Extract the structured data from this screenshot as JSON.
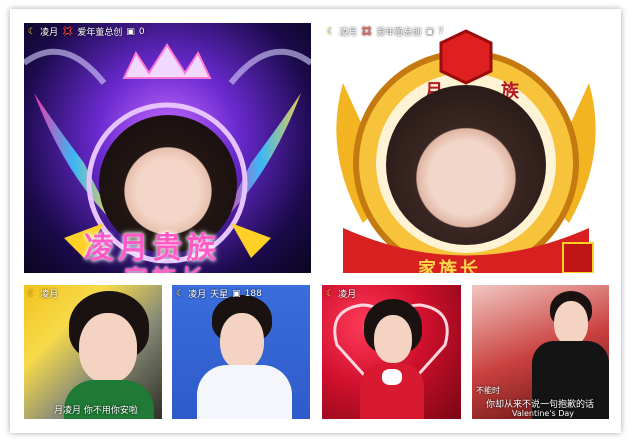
{
  "tiles": [
    {
      "hud": {
        "prefix": "凌月",
        "flag": "💢",
        "name": "爱年董总创",
        "count": "0"
      },
      "title_lines": [
        "凌月贵族",
        "家族长"
      ]
    },
    {
      "hud": {
        "prefix": "凌月",
        "flag": "💢",
        "name": "爱年董总创",
        "count": "7"
      },
      "banner": [
        "月",
        "族"
      ],
      "bottom": "家族长"
    },
    {
      "hud": {
        "prefix": "凌月",
        "name": "",
        "count": ""
      },
      "caption": "月凌月 你不用你安啦"
    },
    {
      "hud": {
        "prefix": "凌月",
        "name": "天星",
        "count": "188"
      }
    },
    {
      "hud": {
        "prefix": "凌月",
        "name": "",
        "count": ""
      }
    },
    {
      "hud": {
        "prefix": "",
        "name": "",
        "count": ""
      },
      "caption_top": "不能时",
      "caption": "你却从来不说一句抱歉的话",
      "caption_bottom": "Valentine's Day"
    }
  ],
  "colors": {
    "gold": "#e8a61c",
    "purple": "#5a1fa8",
    "red": "#c8142a",
    "blue": "#2a5bd7"
  }
}
